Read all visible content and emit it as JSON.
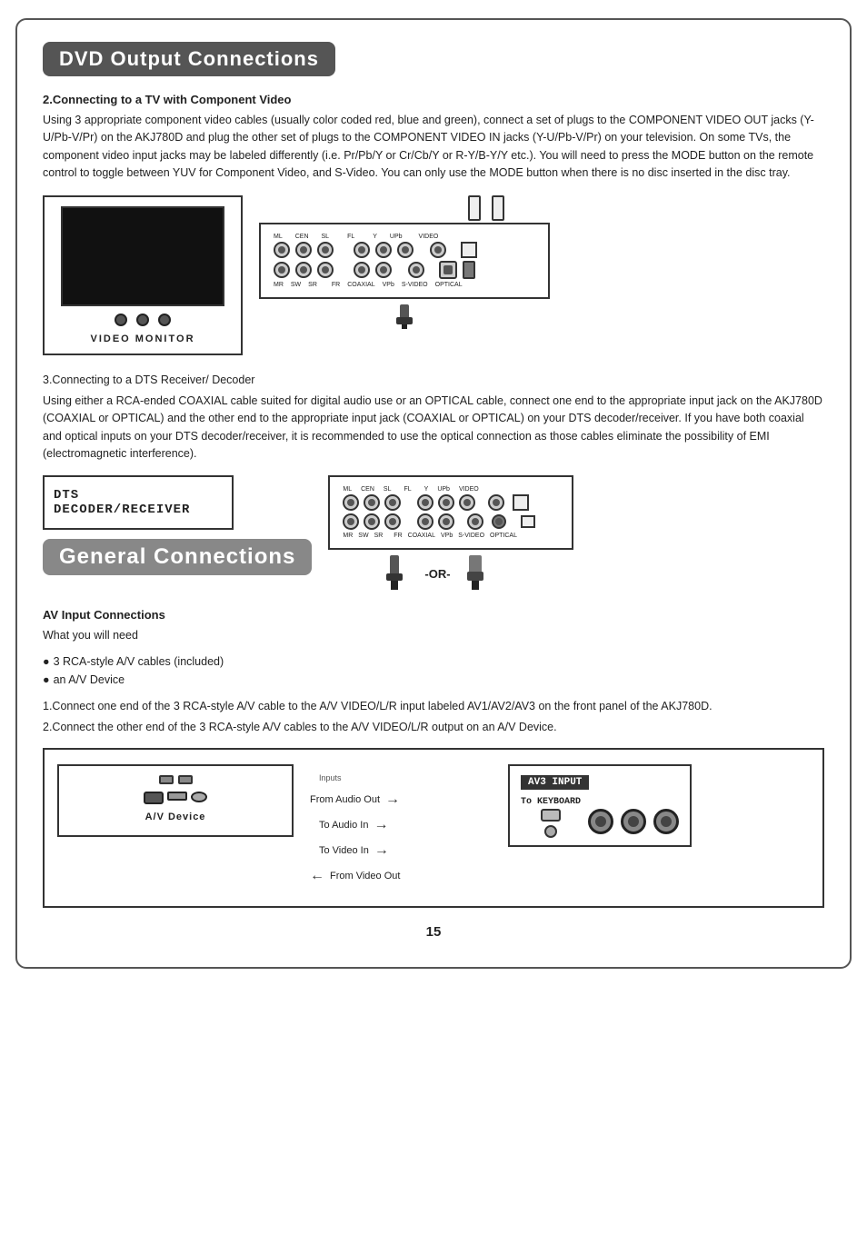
{
  "page": {
    "title": "DVD Output Connections",
    "general_title": "General Connections",
    "page_number": "15"
  },
  "dvd_section": {
    "section2_heading": "2.Connecting to a TV with Component Video",
    "section2_body": "Using 3 appropriate component video cables (usually color coded red, blue and green), connect a set of plugs to the COMPONENT VIDEO OUT jacks (Y-U/Pb-V/Pr) on the AKJ780D and plug the other set of plugs to the COMPONENT VIDEO IN jacks (Y-U/Pb-V/Pr) on your television. On some TVs,  the component video input jacks may be labeled differently (i.e. Pr/Pb/Y or Cr/Cb/Y or R-Y/B-Y/Y etc.).  You will need to press the MODE button on the remote control to toggle between YUV for Component Video, and S-Video. You can only use the MODE button when there is no disc inserted in the disc tray.",
    "video_monitor_label": "VIDEO MONITOR",
    "panel_labels_top": [
      "ML",
      "CEN",
      "SL",
      "FL",
      "Y",
      "UPb",
      "VIDEO"
    ],
    "panel_labels_bottom": [
      "MR",
      "SW",
      "SR",
      "FR",
      "COAXIAL",
      "VPb",
      "S-VIDEO",
      "OPTICAL"
    ],
    "section3_heading": "3.Connecting to a DTS Receiver/ Decoder",
    "section3_body": "Using either a RCA-ended COAXIAL cable suited for digital audio use or an OPTICAL cable, connect one end to the appropriate input jack on the AKJ780D (COAXIAL or OPTICAL) and the other end to the appropriate input jack (COAXIAL or OPTICAL) on your DTS decoder/receiver. If you have both coaxial and optical inputs on your DTS decoder/receiver, it is recommended to use the optical connection as those cables eliminate the possibility of EMI (electromagnetic interference).",
    "dts_label": "DTS DECODER/RECEIVER",
    "or_label": "-OR-"
  },
  "general_section": {
    "av_input_heading": "AV Input Connections",
    "what_you_need": "What you will need",
    "bullets": [
      "3 RCA-style A/V cables (included)",
      "an A/V Device"
    ],
    "step1": "1.Connect one end of the 3 RCA-style A/V cable to the A/V VIDEO/L/R input labeled AV1/AV2/AV3 on the front panel of the AKJ780D.",
    "step2": "2.Connect the other end of the 3 RCA-style A/V cables to the A/V VIDEO/L/R output on an A/V Device.",
    "arrows": {
      "to_audio_in": "To Audio In",
      "to_video_in": "To Video In",
      "from_audio_out": "From Audio Out",
      "from_video_out": "From Video Out",
      "inputs": "Inputs"
    },
    "av_device_label": "A/V Device",
    "av3_title": "AV3 INPUT",
    "to_keyboard": "To KEYBOARD"
  }
}
